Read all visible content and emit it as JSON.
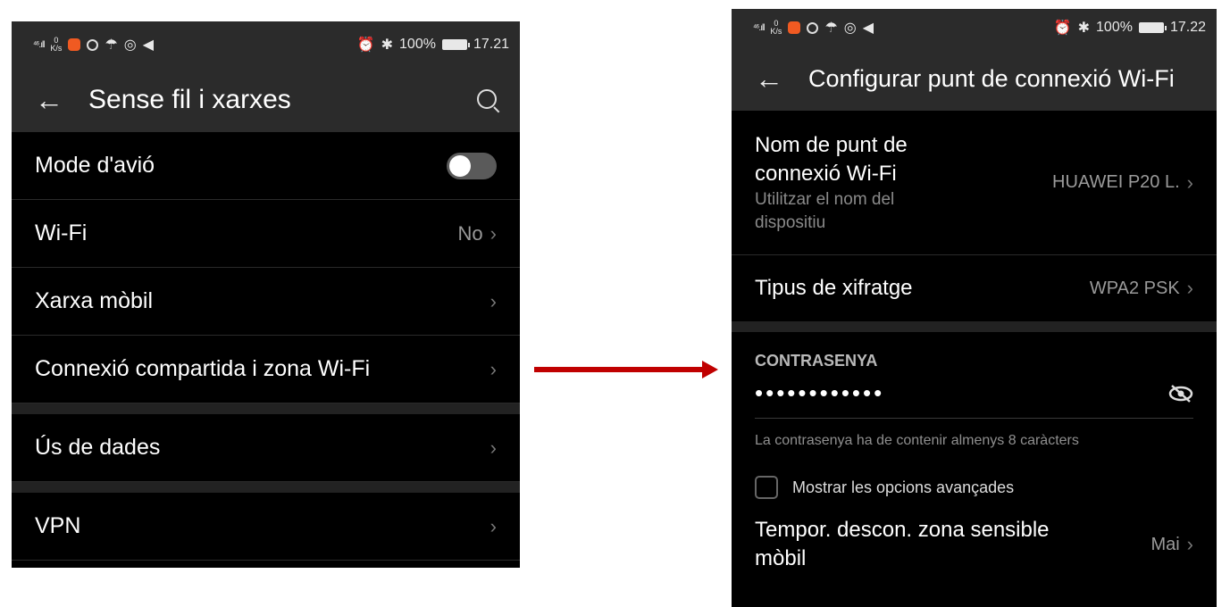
{
  "left": {
    "status": {
      "signal": "⁴⁶.ıll",
      "speed_top": "0",
      "speed_bottom": "K/s",
      "battery": "100%",
      "time": "17.21"
    },
    "title": "Sense fil i xarxes",
    "items": [
      {
        "label": "Mode d'avió"
      },
      {
        "label": "Wi-Fi",
        "value": "No"
      },
      {
        "label": "Xarxa mòbil"
      },
      {
        "label": "Connexió compartida i zona Wi-Fi"
      },
      {
        "label": "Ús de dades"
      },
      {
        "label": "VPN"
      }
    ]
  },
  "right": {
    "status": {
      "signal": "⁴⁶.ıll",
      "speed_top": "0",
      "speed_bottom": "K/s",
      "battery": "100%",
      "time": "17.22"
    },
    "title": "Configurar punt de connexió Wi-Fi",
    "hotspot": {
      "label_1": "Nom de punt de",
      "label_2": "connexió Wi-Fi",
      "sub_1": "Utilitzar el nom del",
      "sub_2": "dispositiu",
      "value": "HUAWEI P20 L."
    },
    "encryption": {
      "label": "Tipus de xifratge",
      "value": "WPA2 PSK"
    },
    "password": {
      "header": "CONTRASENYA",
      "dots": "••••••••••••",
      "hint": "La contrasenya ha de contenir almenys 8 caràcters"
    },
    "advanced": {
      "label": "Mostrar les opcions avançades"
    },
    "timeout": {
      "label_1": "Tempor. descon. zona sensible",
      "label_2": "mòbil",
      "value": "Mai"
    }
  },
  "colors": {
    "arrow": "#c00000",
    "bar": "#2b2b2b"
  },
  "icons": [
    "back-arrow-icon",
    "search-icon",
    "chevron-right-icon",
    "eye-off-icon",
    "battery-icon",
    "bluetooth-icon",
    "alarm-icon"
  ]
}
